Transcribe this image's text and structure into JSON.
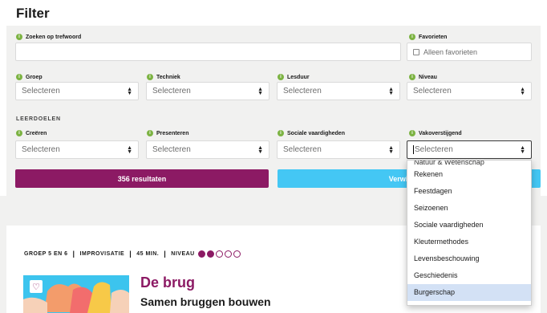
{
  "title": "Filter",
  "fields": {
    "keyword": {
      "label": "Zoeken op trefwoord",
      "value": ""
    },
    "favorites": {
      "label": "Favorieten",
      "option": "Alleen favorieten"
    },
    "groep": {
      "label": "Groep",
      "value": "Selecteren"
    },
    "techniek": {
      "label": "Techniek",
      "value": "Selecteren"
    },
    "lesduur": {
      "label": "Lesduur",
      "value": "Selecteren"
    },
    "niveau": {
      "label": "Niveau",
      "value": "Selecteren"
    },
    "creeren": {
      "label": "Creëren",
      "value": "Selecteren"
    },
    "presenteren": {
      "label": "Presenteren",
      "value": "Selecteren"
    },
    "sociale": {
      "label": "Sociale vaardigheden",
      "value": "Selecteren"
    },
    "vakoverstijgend": {
      "label": "Vakoverstijgend",
      "value": "Selecteren"
    }
  },
  "section_leerdoelen": "LEERDOELEN",
  "buttons": {
    "results": "356 resultaten",
    "clear": "Verwijder fil"
  },
  "dropdown": {
    "partial": "Natuur & Wetenschap",
    "options": [
      "Rekenen",
      "Feestdagen",
      "Seizoenen",
      "Sociale vaardigheden",
      "Kleutermethodes",
      "Levensbeschouwing",
      "Geschiedenis",
      "Burgerschap"
    ],
    "highlighted": "Burgerschap"
  },
  "card": {
    "groep": "GROEP 5 EN 6",
    "techniek": "IMPROVISATIE",
    "duur": "45 MIN.",
    "niveau_label": "NIVEAU",
    "niveau_value": 2,
    "niveau_max": 5,
    "title": "De brug",
    "subtitle": "Samen bruggen bouwen"
  },
  "colors": {
    "primary": "#8c1a64",
    "secondary": "#44c7f4",
    "info": "#7cb342",
    "highlight": "#d3e1f5"
  },
  "icons": {
    "info": "info-icon",
    "favorite": "heart-icon",
    "select": "sort-arrows-icon"
  }
}
